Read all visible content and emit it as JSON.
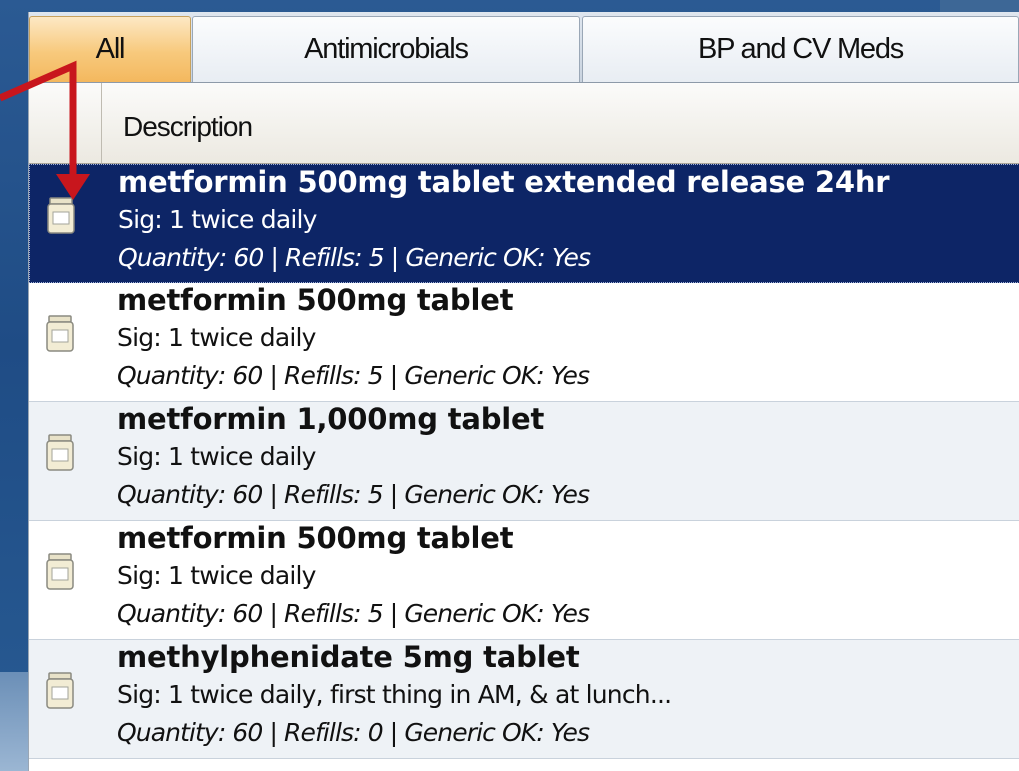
{
  "tabs": [
    {
      "label": "All",
      "active": true
    },
    {
      "label": "Antimicrobials",
      "active": false
    },
    {
      "label": "BP and CV Meds",
      "active": false
    }
  ],
  "table": {
    "column_header": "Description",
    "rows": [
      {
        "name": "metformin 500mg tablet extended release 24hr",
        "sig": "Sig: 1 twice daily",
        "details": "Quantity: 60 | Refills: 5 | Generic OK: Yes",
        "selected": true
      },
      {
        "name": "metformin 500mg tablet",
        "sig": "Sig: 1 twice daily",
        "details": "Quantity: 60 | Refills: 5 | Generic OK: Yes",
        "selected": false
      },
      {
        "name": "metformin 1,000mg tablet",
        "sig": "Sig: 1 twice daily",
        "details": "Quantity: 60 | Refills: 5 | Generic OK: Yes",
        "selected": false
      },
      {
        "name": "metformin 500mg tablet",
        "sig": "Sig: 1 twice daily",
        "details": "Quantity: 60 | Refills: 5 | Generic OK: Yes",
        "selected": false
      },
      {
        "name": "methylphenidate 5mg tablet",
        "sig": "Sig: 1 twice daily, first thing in AM, & at lunch...",
        "details": "Quantity: 60 | Refills: 0 | Generic OK: Yes",
        "selected": false
      }
    ]
  },
  "icons": {
    "row_icon": "prescription-bottle-icon",
    "annotation": "red-arrow-icon"
  },
  "colors": {
    "selected_row": "#0d2566",
    "active_tab": "#f7c97c",
    "annotation_arrow": "#c8161d"
  }
}
